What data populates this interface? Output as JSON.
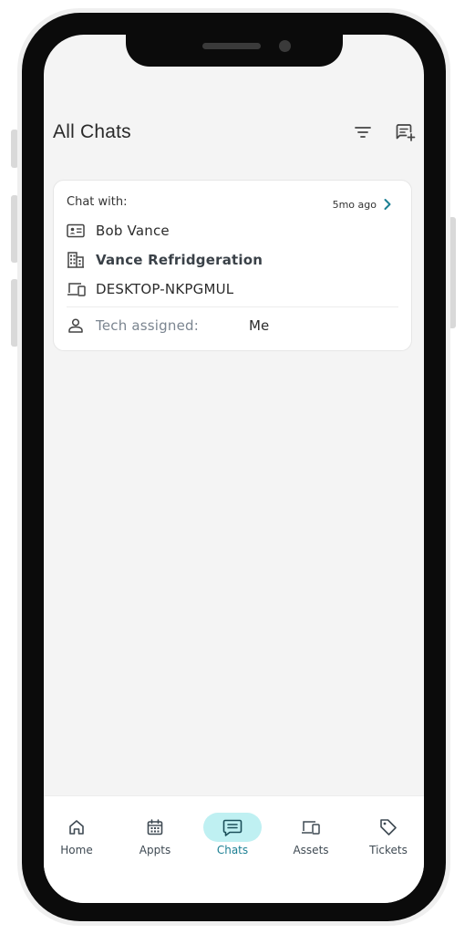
{
  "header": {
    "title": "All Chats",
    "filter_icon": "filter-icon",
    "new_chat_icon": "new-chat-icon"
  },
  "chat_card": {
    "heading": "Chat with:",
    "time_ago": "5mo ago",
    "contact_name": "Bob Vance",
    "company": "Vance Refridgeration",
    "device": "DESKTOP-NKPGMUL",
    "tech_label": "Tech assigned:",
    "tech_value": "Me"
  },
  "bottom_nav": {
    "items": [
      {
        "label": "Home",
        "icon": "home-icon",
        "active": false
      },
      {
        "label": "Appts",
        "icon": "calendar-icon",
        "active": false
      },
      {
        "label": "Chats",
        "icon": "chat-icon",
        "active": true
      },
      {
        "label": "Assets",
        "icon": "devices-icon",
        "active": false
      },
      {
        "label": "Tickets",
        "icon": "tag-icon",
        "active": false
      }
    ]
  },
  "colors": {
    "accent": "#1b7f93",
    "active_pill": "#bff0f2",
    "screen_bg": "#f4f4f4",
    "card_bg": "#ffffff",
    "frame": "#0b0b0b"
  }
}
